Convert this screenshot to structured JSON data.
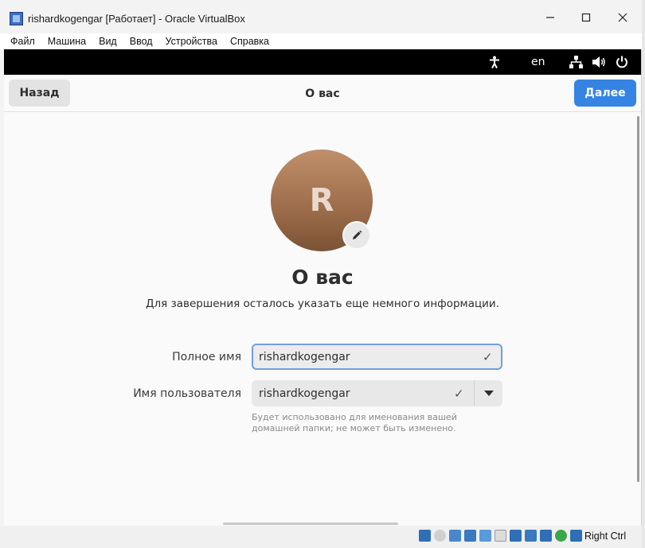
{
  "window": {
    "title": "rishardkogengar [Работает] - Oracle VirtualBox",
    "minimize": "—",
    "maximize": "☐",
    "close": "✕"
  },
  "menu": [
    "Файл",
    "Машина",
    "Вид",
    "Ввод",
    "Устройства",
    "Справка"
  ],
  "topbar": {
    "language": "en",
    "icons": [
      "accessibility-icon",
      "network-icon",
      "volume-icon",
      "power-icon"
    ]
  },
  "header": {
    "back_label": "Назад",
    "title": "О вас",
    "next_label": "Далее"
  },
  "avatar": {
    "letter": "R"
  },
  "main": {
    "title": "О вас",
    "subtitle": "Для завершения осталось указать еще немного информации."
  },
  "form": {
    "full_name_label": "Полное имя",
    "full_name_value": "rishardkogengar",
    "username_label": "Имя пользователя",
    "username_value": "rishardkogengar",
    "hint": "Будет использовано для именования вашей домашней папки; не может быть изменено."
  },
  "statusbar": {
    "host_key": "Right Ctrl"
  },
  "colors": {
    "accent": "#3584e4",
    "topbar": "#000000"
  }
}
